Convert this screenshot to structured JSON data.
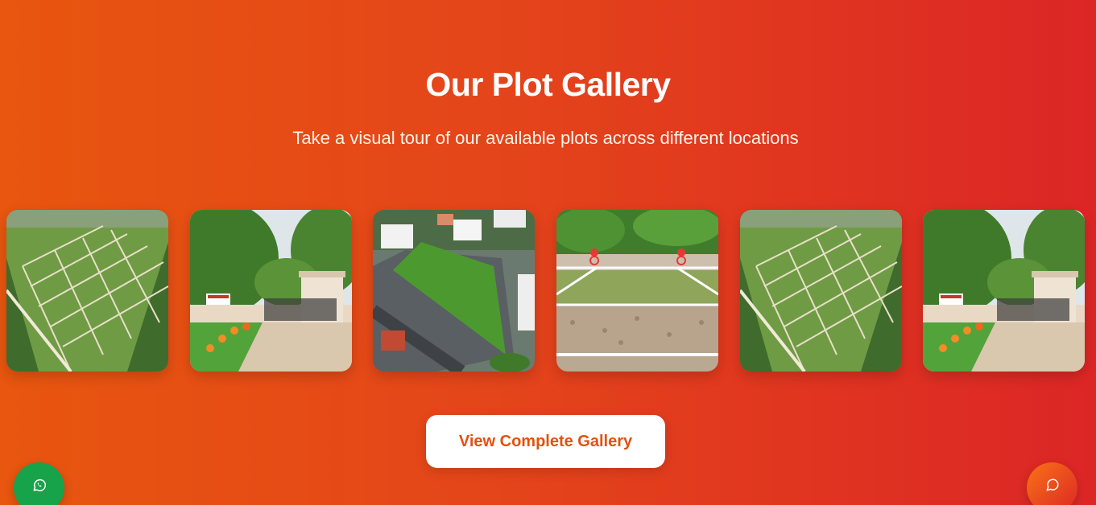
{
  "gallery": {
    "title": "Our Plot Gallery",
    "subtitle": "Take a visual tour of our available plots across different locations",
    "images": [
      {
        "name": "aerial-plot-layout-image"
      },
      {
        "name": "entrance-gate-image"
      },
      {
        "name": "aerial-green-plot-image"
      },
      {
        "name": "plot-boundary-markers-image"
      },
      {
        "name": "aerial-plot-layout-image"
      },
      {
        "name": "entrance-gate-image"
      }
    ],
    "cta_label": "View Complete Gallery"
  },
  "floating": {
    "whatsapp_icon": "whatsapp-icon",
    "chat_icon": "chat-bubble-icon"
  },
  "colors": {
    "gradient_start": "#e8560f",
    "gradient_end": "#dc2626",
    "cta_text": "#e4500f",
    "whatsapp": "#16a34a"
  }
}
